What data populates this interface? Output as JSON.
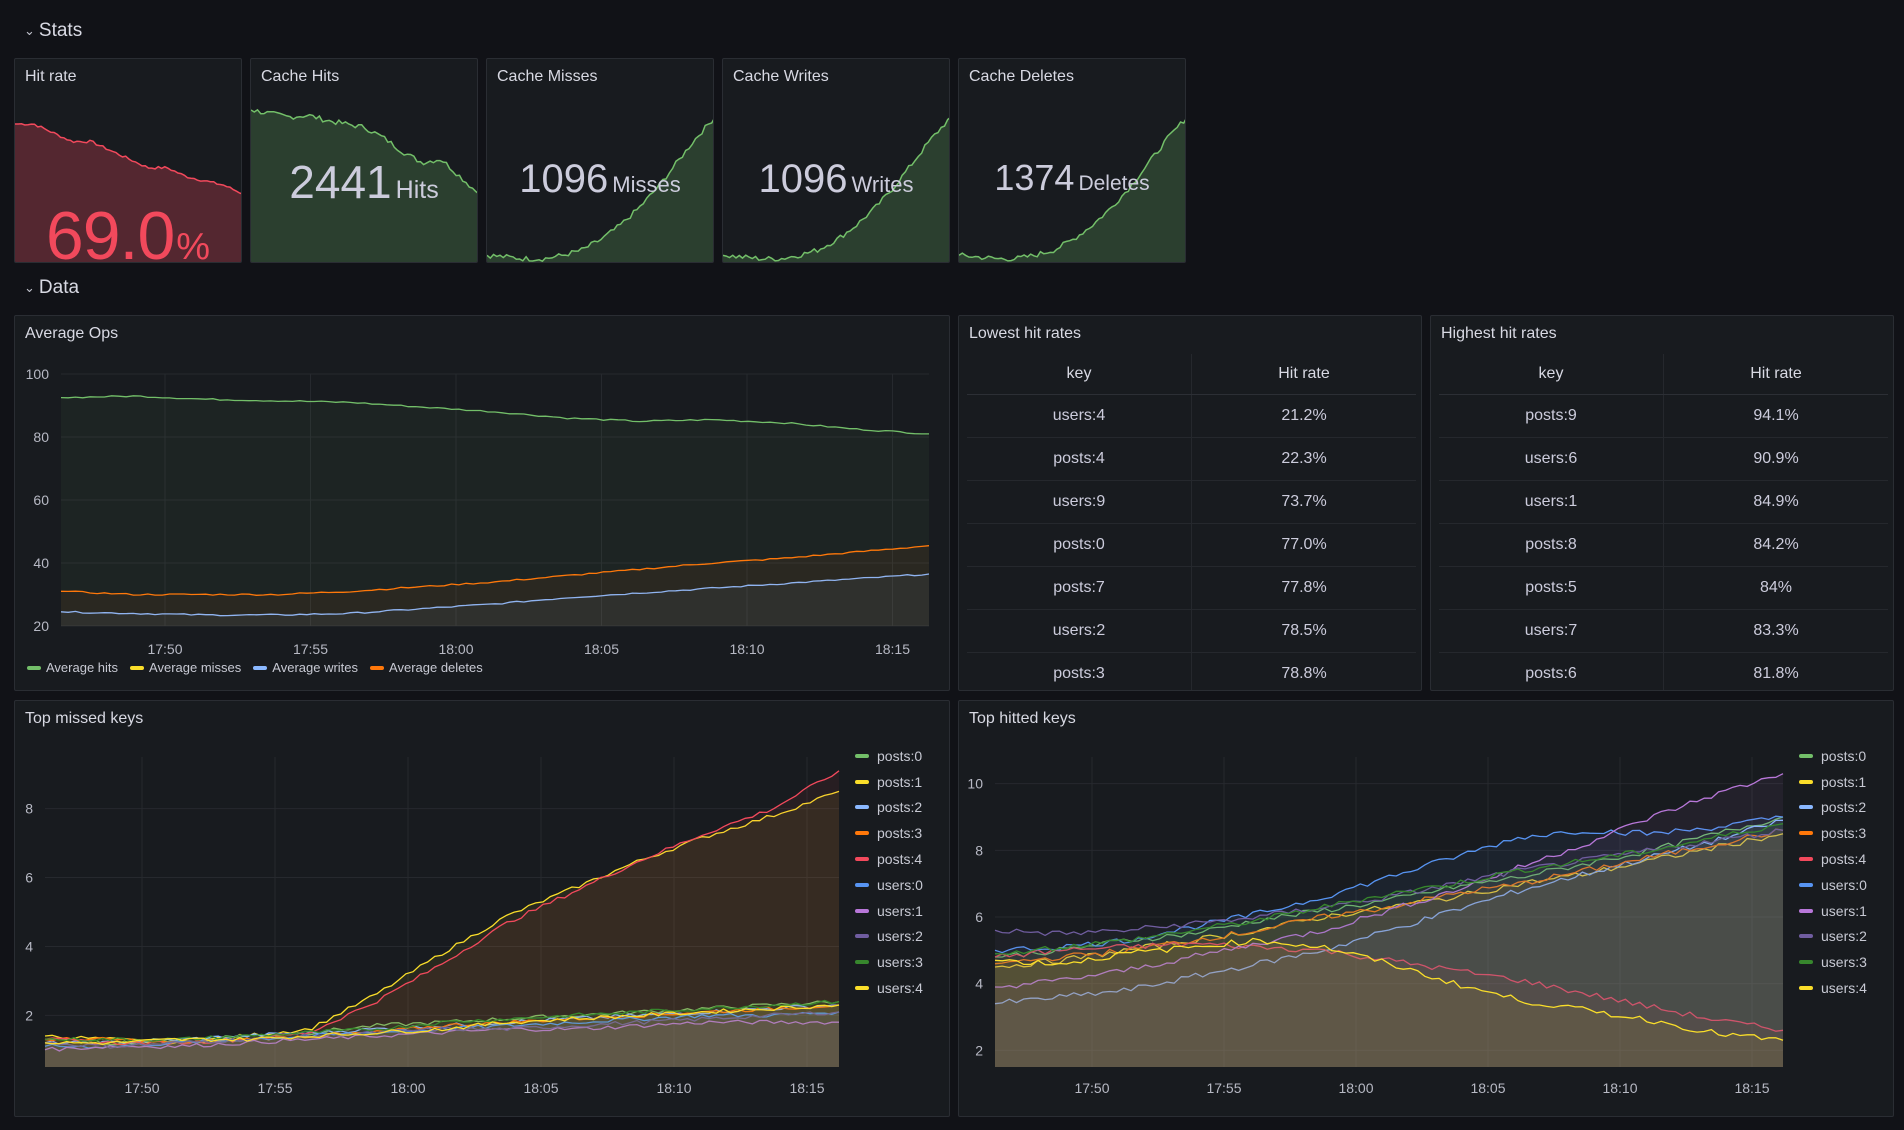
{
  "rows": {
    "stats": "Stats",
    "data": "Data"
  },
  "stats": [
    {
      "title": "Hit rate",
      "value": "69.0",
      "unit": "%",
      "color": "#f2495c"
    },
    {
      "title": "Cache Hits",
      "value": "2441",
      "unit": "Hits",
      "color": "#73bf69"
    },
    {
      "title": "Cache Misses",
      "value": "1096",
      "unit": "Misses",
      "color": "#73bf69"
    },
    {
      "title": "Cache Writes",
      "value": "1096",
      "unit": "Writes",
      "color": "#73bf69"
    },
    {
      "title": "Cache Deletes",
      "value": "1374",
      "unit": "Deletes",
      "color": "#73bf69"
    }
  ],
  "avg_ops": {
    "title": "Average Ops",
    "legend": [
      {
        "name": "Average hits",
        "color": "#73bf69"
      },
      {
        "name": "Average misses",
        "color": "#fade2a"
      },
      {
        "name": "Average writes",
        "color": "#8ab8ff"
      },
      {
        "name": "Average deletes",
        "color": "#ff780a"
      }
    ]
  },
  "lowest": {
    "title": "Lowest hit rates",
    "headers": [
      "key",
      "Hit rate"
    ],
    "rows": [
      [
        "users:4",
        "21.2%"
      ],
      [
        "posts:4",
        "22.3%"
      ],
      [
        "users:9",
        "73.7%"
      ],
      [
        "posts:0",
        "77.0%"
      ],
      [
        "posts:7",
        "77.8%"
      ],
      [
        "users:2",
        "78.5%"
      ],
      [
        "posts:3",
        "78.8%"
      ]
    ]
  },
  "highest": {
    "title": "Highest hit rates",
    "headers": [
      "key",
      "Hit rate"
    ],
    "rows": [
      [
        "posts:9",
        "94.1%"
      ],
      [
        "users:6",
        "90.9%"
      ],
      [
        "users:1",
        "84.9%"
      ],
      [
        "posts:8",
        "84.2%"
      ],
      [
        "posts:5",
        "84%"
      ],
      [
        "users:7",
        "83.3%"
      ],
      [
        "posts:6",
        "81.8%"
      ]
    ]
  },
  "top_missed": {
    "title": "Top missed keys"
  },
  "top_hitted": {
    "title": "Top hitted keys"
  },
  "key_legend": [
    {
      "name": "posts:0",
      "color": "#73bf69"
    },
    {
      "name": "posts:1",
      "color": "#fade2a"
    },
    {
      "name": "posts:2",
      "color": "#8ab8ff"
    },
    {
      "name": "posts:3",
      "color": "#ff780a"
    },
    {
      "name": "posts:4",
      "color": "#f2495c"
    },
    {
      "name": "users:0",
      "color": "#5794f2"
    },
    {
      "name": "users:1",
      "color": "#b877d9"
    },
    {
      "name": "users:2",
      "color": "#705da0"
    },
    {
      "name": "users:3",
      "color": "#37872d"
    },
    {
      "name": "users:4",
      "color": "#fade2a"
    }
  ],
  "chart_data": [
    {
      "type": "line",
      "title": "Average Ops",
      "x_ticks": [
        "17:50",
        "17:55",
        "18:00",
        "18:05",
        "18:10",
        "18:15"
      ],
      "ylim": [
        20,
        100
      ],
      "y_ticks": [
        20,
        40,
        60,
        80,
        100
      ],
      "grid": true,
      "legend": "bottom",
      "series": [
        {
          "name": "Average hits",
          "values": [
            92.5,
            93,
            92,
            91.5,
            91,
            89.5,
            88,
            86,
            85,
            85.5,
            84.5,
            82.5,
            81
          ]
        },
        {
          "name": "Average misses",
          "values": [
            null
          ]
        },
        {
          "name": "Average writes",
          "values": [
            24.5,
            24,
            23.5,
            23.5,
            24,
            25.5,
            27,
            29,
            30.5,
            32,
            33.5,
            35,
            36.5
          ]
        },
        {
          "name": "Average deletes",
          "values": [
            31,
            30,
            30,
            30,
            31,
            32.5,
            34,
            36,
            38,
            40,
            41.5,
            43.5,
            45.5
          ]
        }
      ]
    },
    {
      "type": "line",
      "title": "Top missed keys",
      "x_ticks": [
        "17:50",
        "17:55",
        "18:00",
        "18:05",
        "18:10",
        "18:15"
      ],
      "ylim": [
        0.5,
        9.5
      ],
      "y_ticks": [
        2,
        4,
        6,
        8
      ],
      "grid": true,
      "legend": "right",
      "series": [
        {
          "name": "posts:0",
          "values": [
            1.3,
            1.2,
            1.3,
            1.4,
            1.5,
            1.7,
            1.8,
            1.9,
            2.0,
            2.1,
            2.2,
            2.3,
            2.4
          ]
        },
        {
          "name": "posts:1",
          "values": [
            1.4,
            1.3,
            1.2,
            1.4,
            1.6,
            2.6,
            3.8,
            4.9,
            5.7,
            6.5,
            7.2,
            7.8,
            8.5
          ]
        },
        {
          "name": "posts:2",
          "values": [
            1.2,
            1.2,
            1.3,
            1.4,
            1.5,
            1.6,
            1.7,
            1.8,
            1.9,
            2.0,
            2.1,
            2.2,
            2.3
          ]
        },
        {
          "name": "posts:3",
          "values": [
            1.3,
            1.3,
            1.2,
            1.3,
            1.4,
            1.5,
            1.7,
            1.8,
            1.9,
            2.0,
            2.1,
            2.2,
            2.3
          ]
        },
        {
          "name": "posts:4",
          "values": [
            1.3,
            1.2,
            1.2,
            1.3,
            1.5,
            2.4,
            3.5,
            4.7,
            5.6,
            6.5,
            7.3,
            8.0,
            9.1
          ]
        },
        {
          "name": "users:0",
          "values": [
            1.1,
            1.1,
            1.2,
            1.3,
            1.4,
            1.5,
            1.6,
            1.7,
            1.8,
            1.9,
            2.0,
            2.0,
            2.1
          ]
        },
        {
          "name": "users:1",
          "values": [
            1.0,
            1.1,
            1.1,
            1.2,
            1.3,
            1.4,
            1.5,
            1.6,
            1.6,
            1.7,
            1.8,
            1.8,
            1.8
          ]
        },
        {
          "name": "users:2",
          "values": [
            1.2,
            1.1,
            1.2,
            1.3,
            1.4,
            1.5,
            1.6,
            1.6,
            1.7,
            1.8,
            1.9,
            2.0,
            2.1
          ]
        },
        {
          "name": "users:3",
          "values": [
            1.3,
            1.3,
            1.3,
            1.4,
            1.5,
            1.6,
            1.8,
            1.9,
            2.0,
            2.1,
            2.2,
            2.3,
            2.4
          ]
        },
        {
          "name": "users:4",
          "values": [
            1.2,
            1.2,
            1.3,
            1.3,
            1.4,
            1.5,
            1.6,
            1.8,
            1.9,
            2.0,
            2.1,
            2.2,
            2.3
          ]
        }
      ]
    },
    {
      "type": "line",
      "title": "Top hitted keys",
      "x_ticks": [
        "17:50",
        "17:55",
        "18:00",
        "18:05",
        "18:10",
        "18:15"
      ],
      "ylim": [
        1.5,
        10.8
      ],
      "y_ticks": [
        2,
        4,
        6,
        8,
        10
      ],
      "grid": true,
      "legend": "right",
      "series": [
        {
          "name": "posts:0",
          "values": [
            4.8,
            5.0,
            5.3,
            5.5,
            5.9,
            6.2,
            6.5,
            6.9,
            7.2,
            7.6,
            8.0,
            8.5,
            9.0
          ]
        },
        {
          "name": "posts:1",
          "values": [
            4.5,
            4.7,
            5.0,
            5.3,
            5.6,
            6.0,
            6.3,
            6.6,
            7.0,
            7.3,
            7.7,
            8.1,
            8.5
          ]
        },
        {
          "name": "posts:2",
          "values": [
            3.4,
            3.6,
            3.8,
            4.2,
            4.6,
            5.0,
            5.6,
            6.2,
            6.8,
            7.3,
            7.8,
            8.3,
            8.9
          ]
        },
        {
          "name": "posts:3",
          "values": [
            4.6,
            4.8,
            5.0,
            5.3,
            5.6,
            6.0,
            6.3,
            6.7,
            7.0,
            7.4,
            7.8,
            8.2,
            8.6
          ]
        },
        {
          "name": "posts:4",
          "values": [
            4.8,
            5.0,
            5.1,
            5.2,
            5.1,
            5.0,
            4.7,
            4.4,
            4.1,
            3.7,
            3.3,
            2.9,
            2.6
          ]
        },
        {
          "name": "users:0",
          "values": [
            5.0,
            5.1,
            5.3,
            5.7,
            6.1,
            6.6,
            7.2,
            7.8,
            8.4,
            8.6,
            8.5,
            8.7,
            9.0
          ]
        },
        {
          "name": "users:1",
          "values": [
            3.9,
            4.1,
            4.4,
            4.8,
            5.2,
            5.6,
            6.2,
            6.8,
            7.5,
            8.2,
            9.0,
            9.7,
            10.3
          ]
        },
        {
          "name": "users:2",
          "values": [
            5.6,
            5.5,
            5.6,
            5.8,
            6.0,
            6.3,
            6.6,
            7.0,
            7.4,
            7.7,
            8.0,
            8.3,
            8.6
          ]
        },
        {
          "name": "users:3",
          "values": [
            4.9,
            5.1,
            5.3,
            5.6,
            5.9,
            6.3,
            6.7,
            7.0,
            7.4,
            7.7,
            8.0,
            8.4,
            8.8
          ]
        },
        {
          "name": "users:4",
          "values": [
            4.7,
            4.6,
            4.9,
            5.1,
            5.3,
            5.1,
            4.6,
            4.0,
            3.5,
            3.2,
            2.9,
            2.5,
            2.3
          ]
        }
      ]
    }
  ],
  "sparklines": {
    "hit_rate": [
      76,
      76,
      75,
      74,
      74,
      73,
      72,
      71,
      71,
      70,
      69.5,
      69,
      68
    ],
    "cache_hits": [
      88,
      86,
      84,
      85,
      82,
      80,
      78,
      72,
      64,
      58,
      60,
      50,
      40
    ],
    "cache_misses": [
      5,
      4,
      3,
      3,
      5,
      8,
      14,
      22,
      32,
      44,
      58,
      72,
      84
    ],
    "cache_writes": [
      5,
      4,
      3,
      3,
      5,
      8,
      14,
      22,
      32,
      44,
      58,
      72,
      84
    ],
    "cache_deletes": [
      5,
      4,
      3,
      3,
      5,
      8,
      14,
      22,
      32,
      44,
      58,
      72,
      84
    ]
  }
}
